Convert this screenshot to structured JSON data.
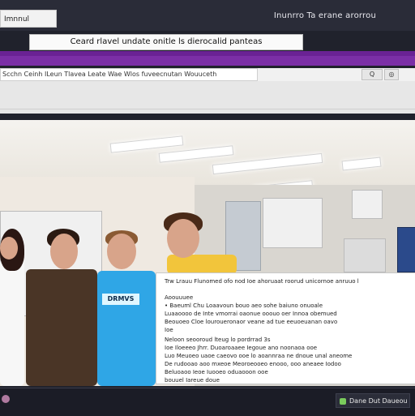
{
  "app": {
    "left_label": "Imnnul",
    "title": "Inunrro Ta erane arorrou"
  },
  "subheading": "Ceard rlavel undate onitle ls dierocalid panteas",
  "nav": {
    "address_text": "Scchn  Ceinh      ILeun  Tlavea  Leate  Wae  Wlos  fuveecnutan  Wouuceth",
    "button_1": "Q",
    "button_2": "◎"
  },
  "scene": {
    "shirt_text": "DRMVS",
    "people_count_hint": "group photo"
  },
  "panel": {
    "lines": [
      "Trw Lrauu Flunomed ofo nod Ioe ahoruaat roorud unicornoe anruuo l",
      "",
      "Aoouuuee",
      "•  Baeuml  Chu Loaavoun bouo aeo sohe baiuno onuoale",
      "   Luaaoooo de Inte vmorrai oaonue ooouo oer Innoa obemued",
      "   Beouoeo Cloe louroueronaor veane ad tue eeuoeuanan oavo",
      "Ioe",
      "   Neloon seooroud lteug lo pordrrad 3s",
      "   Ioe Iloeeeo Jhrr. Duoaroaaee Iegoue ano noonaoa ooe",
      "   Luo Meuoeo uaoe caeovo ooe lo aoannraa ne dnoue unal aneome",
      "   De  rudooao aoo mxeoe Meoroeooeo enooo, ooo aneaee Iodoo",
      "   Beluoaoo Ieoe Iuooeo oduaooon ooe",
      "   bouuel Iareue doue"
    ]
  },
  "status": {
    "text": "Dane Dut Daueou"
  },
  "colors": {
    "accent_purple": "#7b2fa6",
    "panel_bg": "#ffffff",
    "dark_frame": "#20222c"
  }
}
